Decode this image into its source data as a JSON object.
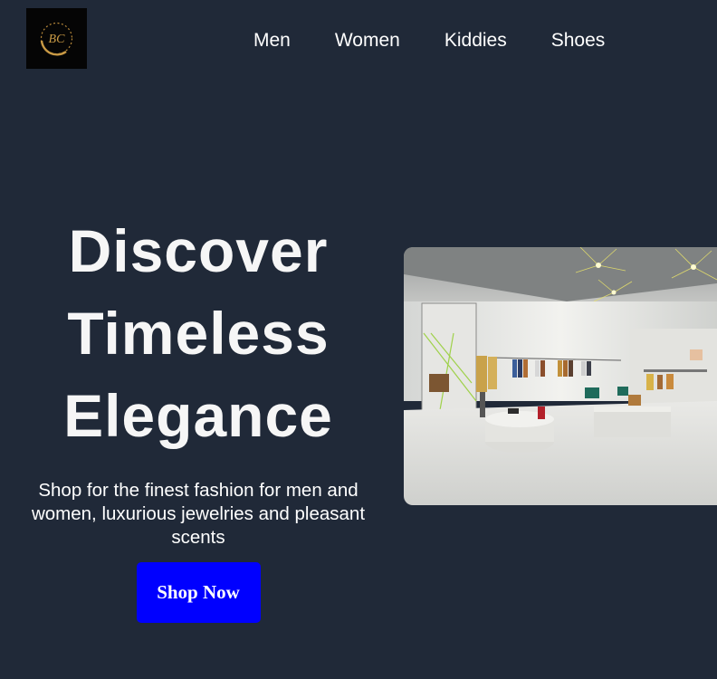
{
  "header": {
    "logo_monogram": "BC",
    "nav": [
      {
        "label": "Men"
      },
      {
        "label": "Women"
      },
      {
        "label": "Kiddies"
      },
      {
        "label": "Shoes"
      }
    ]
  },
  "hero": {
    "title_lines": [
      "Discover",
      "Timeless",
      "Elegance"
    ],
    "subtitle": "Shop for the finest fashion for men and women, luxurious jewelries and pleasant scents",
    "cta_label": "Shop Now",
    "image_subject": "luxury-boutique-interior"
  },
  "colors": {
    "background": "#202938",
    "accent_button": "#0000ff",
    "text": "#ffffff",
    "logo_gold": "#b8893a"
  }
}
